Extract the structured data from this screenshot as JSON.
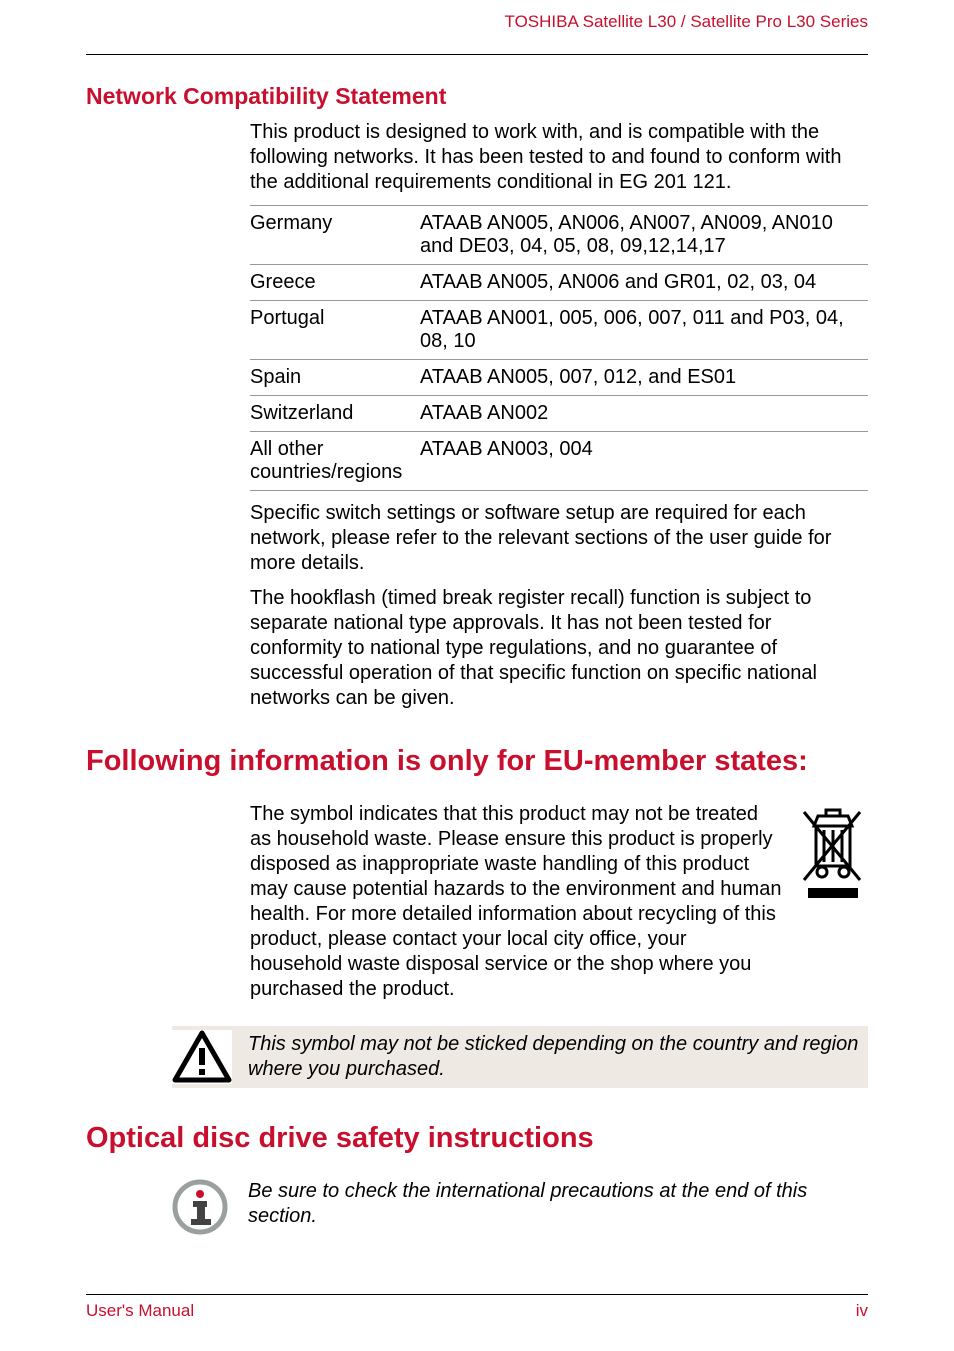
{
  "colors": {
    "accent": "#c8102e"
  },
  "header": {
    "product_line": "TOSHIBA Satellite L30 / Satellite Pro L30 Series"
  },
  "section_network": {
    "title": "Network Compatibility Statement",
    "intro": "This product is designed to work with, and is compatible with the following networks. It has been tested to and found to conform with the additional requirements conditional in EG 201 121.",
    "rows": [
      {
        "country": "Germany",
        "codes": "ATAAB AN005, AN006, AN007, AN009, AN010 and DE03, 04, 05, 08, 09,12,14,17"
      },
      {
        "country": "Greece",
        "codes": "ATAAB AN005, AN006 and GR01, 02, 03, 04"
      },
      {
        "country": "Portugal",
        "codes": "ATAAB AN001, 005, 006, 007, 011 and P03, 04, 08, 10"
      },
      {
        "country": "Spain",
        "codes": "ATAAB AN005, 007, 012, and ES01"
      },
      {
        "country": "Switzerland",
        "codes": "ATAAB AN002"
      },
      {
        "country": "All other countries/regions",
        "codes": "ATAAB AN003, 004"
      }
    ],
    "para2": "Specific switch settings or software setup are required for each network, please refer to the relevant sections of the user guide for more details.",
    "para3": "The hookflash (timed break register recall) function is subject to separate national type approvals. It has not been tested for conformity to national type regulations, and no guarantee of successful operation of that specific function on specific national networks can be given."
  },
  "section_eu": {
    "title": "Following information is only for EU-member states:",
    "para": "The symbol indicates that this product may not be treated as household waste. Please ensure this product is properly disposed as inappropriate waste handling of this product may cause potential hazards to the environment and human health. For more detailed information about recycling of this product, please contact your local city office, your household waste disposal service or the shop where you purchased the product.",
    "caution": "This symbol may not be sticked depending on the country and region where you purchased.",
    "icons": {
      "weee": "weee-bin-icon",
      "caution": "caution-triangle-icon"
    }
  },
  "section_odd": {
    "title": "Optical disc drive safety instructions",
    "note": "Be sure to check the international precautions at the end of this section.",
    "icons": {
      "info": "info-icon"
    }
  },
  "footer": {
    "left": "User's Manual",
    "right": "iv"
  }
}
